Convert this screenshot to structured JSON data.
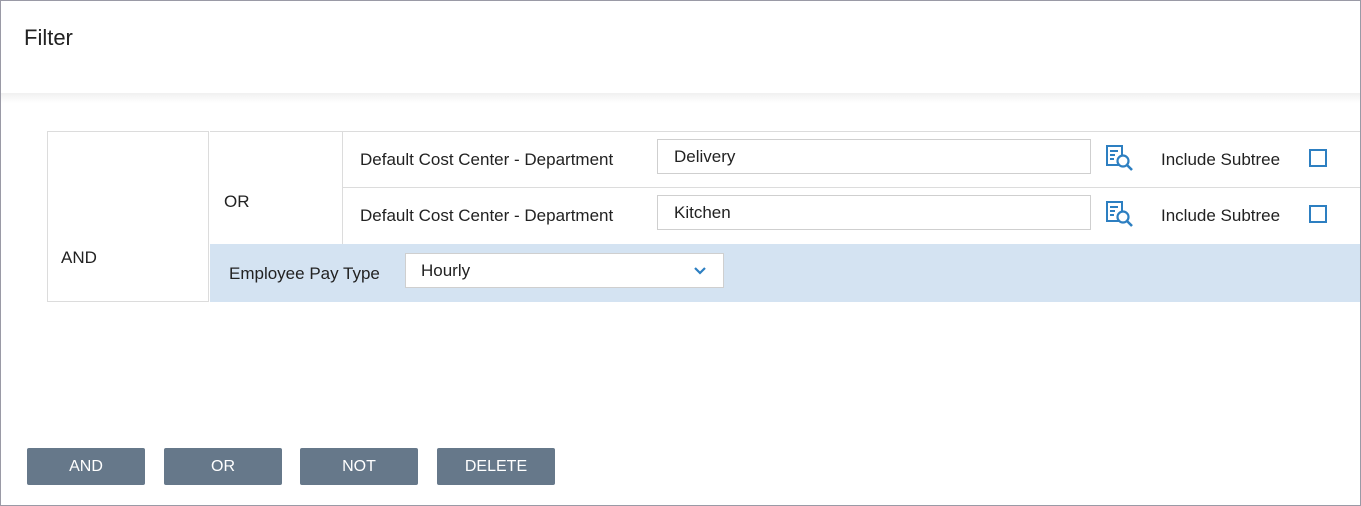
{
  "dialog": {
    "title": "Filter"
  },
  "filter": {
    "and_label": "AND",
    "or_label": "OR",
    "rows": [
      {
        "label": "Default Cost Center - Department",
        "value": "Delivery",
        "subtree_label": "Include Subtree",
        "include_subtree": false
      },
      {
        "label": "Default Cost Center - Department",
        "value": "Kitchen",
        "subtree_label": "Include Subtree",
        "include_subtree": false
      }
    ],
    "pay_type": {
      "label": "Employee Pay Type",
      "value": "Hourly"
    }
  },
  "buttons": {
    "and": "AND",
    "or": "OR",
    "not": "NOT",
    "delete": "DELETE"
  },
  "icons": {
    "lookup": "lookup-search-icon",
    "dropdown": "chevron-down-icon"
  },
  "colors": {
    "accent": "#2d7fc1",
    "button_bg": "#66788a",
    "highlight_row": "#d4e3f2"
  }
}
